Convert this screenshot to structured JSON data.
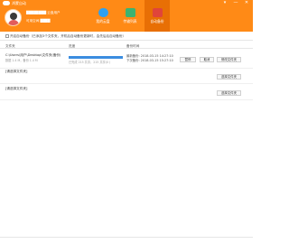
{
  "window": {
    "title": "鸿蒙自动",
    "controls": [
      "▾",
      "—",
      "✕"
    ]
  },
  "user": {
    "line1": "████████ 云盘用户",
    "line2": "可用空间 ████"
  },
  "nav": {
    "tabs": [
      {
        "label": "我的云盘",
        "icon": "cloud-icon",
        "color": "#2ea0f0",
        "active": false
      },
      {
        "label": "传输列表",
        "icon": "transfer-icon",
        "color": "#3cb371",
        "active": false
      },
      {
        "label": "自动备份",
        "icon": "backup-icon",
        "color": "#e0453a",
        "active": true
      }
    ]
  },
  "toolbar": {
    "checkbox_text": "开启自动备份（已添加3个文件夹，开机后自动备份更新时，会先后后自动备份）"
  },
  "table": {
    "headers": {
      "folder": "文件夹",
      "progress": "进度",
      "time": "备份时间"
    }
  },
  "rows": [
    {
      "path": "C:\\Users\\用户\\Desktop\\文件夹(备份)",
      "status": "数据 1.4 M，备份 1.4 M",
      "progress_percent": 100,
      "progress_text": "已完成 215 共享，215 共享(0 )",
      "time_label_1": "最新备份: 2018-03-15 14:27:10",
      "time_label_2": "下次备份: 2018-03-15 15:27:10",
      "buttons": [
        "暂停",
        "取消",
        "修改文件夹"
      ]
    },
    {
      "path": "[请选择文件夹]",
      "button": "选择文件夹"
    },
    {
      "path": "[请选择文件夹]",
      "button": "选择文件夹"
    }
  ]
}
